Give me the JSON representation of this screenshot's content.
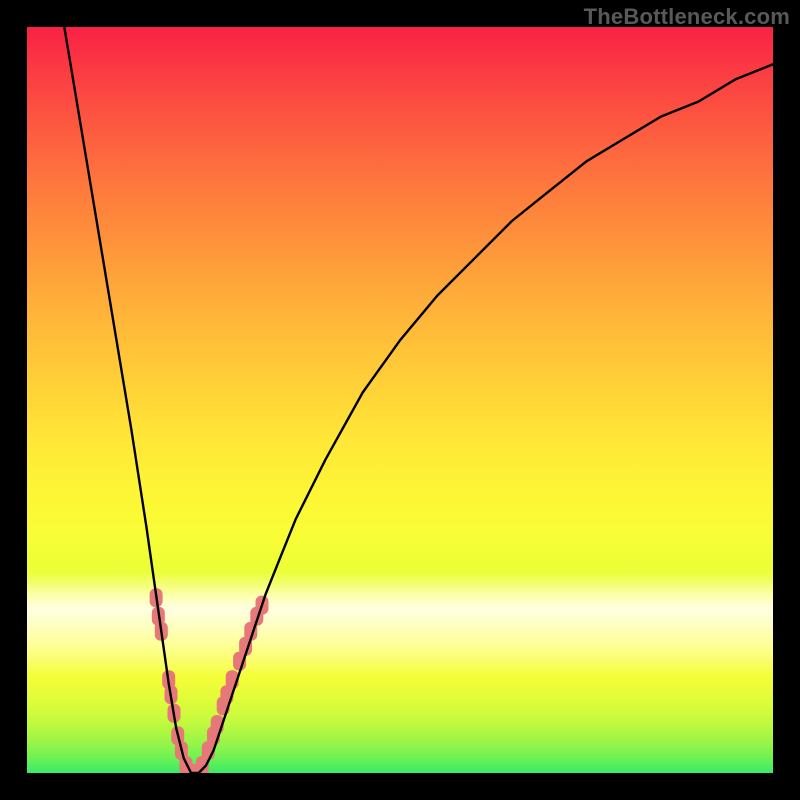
{
  "watermark": "TheBottleneck.com",
  "colors": {
    "frame": "#000000",
    "marker": "rgb(230,120,120)",
    "curve": "#000000"
  },
  "chart_data": {
    "type": "line",
    "title": "",
    "xlabel": "",
    "ylabel": "",
    "xlim": [
      0,
      100
    ],
    "ylim": [
      0,
      100
    ],
    "grid": false,
    "legend": false,
    "series": [
      {
        "name": "bottleneck-curve",
        "x": [
          5,
          6,
          8,
          10,
          12,
          14,
          16,
          18,
          19,
          20,
          21,
          22,
          23,
          24,
          25,
          26,
          28,
          30,
          32,
          34,
          36,
          40,
          45,
          50,
          55,
          60,
          65,
          70,
          75,
          80,
          85,
          90,
          95,
          100
        ],
        "y": [
          100,
          94,
          82,
          70,
          58,
          46,
          33,
          19,
          12,
          6,
          2,
          0,
          0,
          1,
          3,
          6,
          12,
          18,
          24,
          29,
          34,
          42,
          51,
          58,
          64,
          69,
          74,
          78,
          82,
          85,
          88,
          90,
          93,
          95
        ]
      }
    ],
    "markers": {
      "name": "highlighted-points",
      "shape": "rounded-rect",
      "color": "rgb(230,120,120)",
      "points": [
        {
          "x": 17.3,
          "y": 23.5
        },
        {
          "x": 17.6,
          "y": 21.0
        },
        {
          "x": 18.0,
          "y": 19.0
        },
        {
          "x": 19.0,
          "y": 12.5
        },
        {
          "x": 19.3,
          "y": 10.5
        },
        {
          "x": 19.7,
          "y": 8.0
        },
        {
          "x": 20.2,
          "y": 5.0
        },
        {
          "x": 20.7,
          "y": 3.0
        },
        {
          "x": 21.3,
          "y": 1.0
        },
        {
          "x": 22.0,
          "y": 0.0
        },
        {
          "x": 22.8,
          "y": 0.0
        },
        {
          "x": 23.5,
          "y": 1.0
        },
        {
          "x": 24.3,
          "y": 3.0
        },
        {
          "x": 25.0,
          "y": 5.0
        },
        {
          "x": 25.5,
          "y": 6.5
        },
        {
          "x": 26.3,
          "y": 9.0
        },
        {
          "x": 26.8,
          "y": 10.5
        },
        {
          "x": 27.5,
          "y": 12.5
        },
        {
          "x": 28.5,
          "y": 15.0
        },
        {
          "x": 29.3,
          "y": 17.0
        },
        {
          "x": 30.0,
          "y": 19.0
        },
        {
          "x": 30.8,
          "y": 21.0
        },
        {
          "x": 31.5,
          "y": 22.5
        }
      ]
    }
  }
}
